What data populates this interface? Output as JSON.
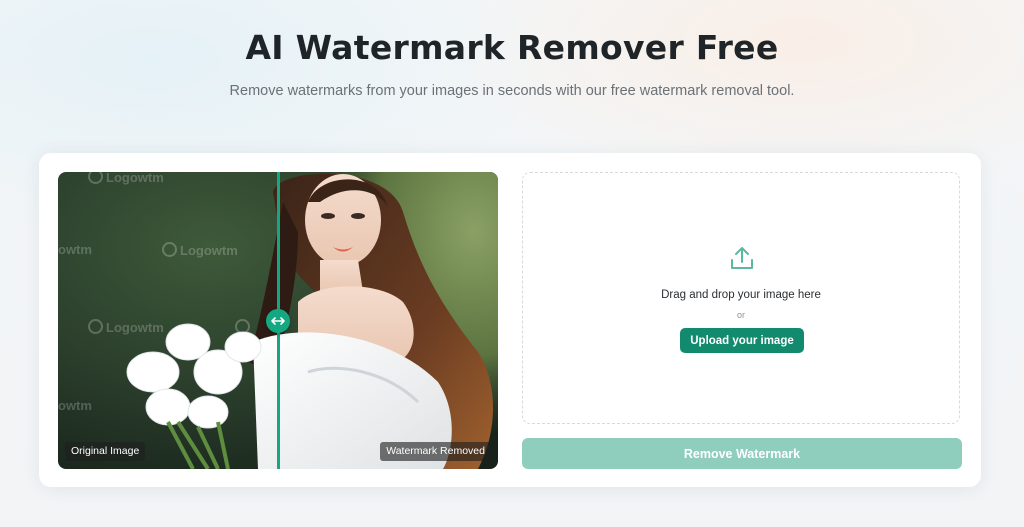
{
  "header": {
    "title": "AI Watermark Remover Free",
    "subtitle": "Remove watermarks from your images in seconds with our free watermark removal tool."
  },
  "comparison": {
    "original_label": "Original Image",
    "removed_label": "Watermark Removed",
    "watermark_text": "Logowtm",
    "watermark_text_partial": "owtm",
    "handle_icon": "left-right-arrows-icon"
  },
  "upload": {
    "icon": "upload-icon",
    "drag_text": "Drag and drop your image here",
    "or_text": "or",
    "button_label": "Upload your image"
  },
  "actions": {
    "remove_label": "Remove Watermark"
  },
  "colors": {
    "accent": "#128a6e",
    "divider": "#14a882",
    "remove_button_disabled": "#8fcdbd"
  }
}
